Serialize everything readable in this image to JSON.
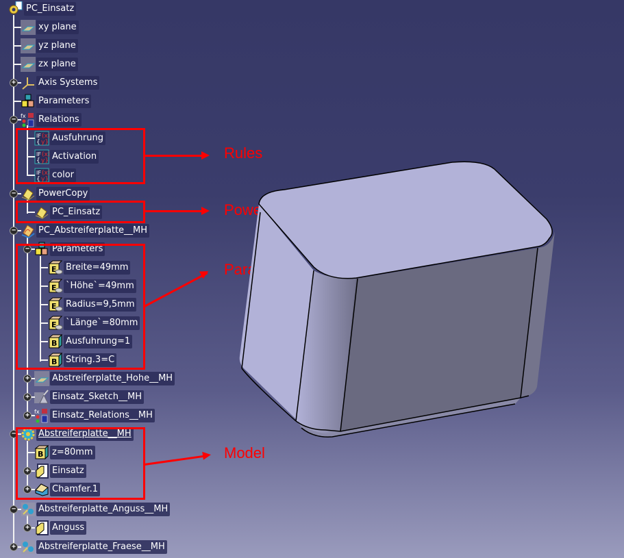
{
  "tree": {
    "root": {
      "label": "PC_Einsatz",
      "icon": "part-gear-icon"
    },
    "items": [
      {
        "label": "xy plane",
        "icon": "plane-icon"
      },
      {
        "label": "yz plane",
        "icon": "plane-icon"
      },
      {
        "label": "zx plane",
        "icon": "plane-icon"
      },
      {
        "label": "Axis Systems",
        "icon": "axis-system-icon",
        "toggle": "+"
      },
      {
        "label": "Parameters",
        "icon": "parameters-icon"
      },
      {
        "label": "Relations",
        "icon": "relations-icon",
        "toggle": "-"
      },
      {
        "label": "Ausfuhrung",
        "icon": "rule-icon"
      },
      {
        "label": "Activation",
        "icon": "rule-icon"
      },
      {
        "label": "color",
        "icon": "rule-icon"
      },
      {
        "label": "PowerCopy",
        "icon": "powercopy-icon",
        "toggle": "-"
      },
      {
        "label": "PC_Einsatz",
        "icon": "powercopy-icon"
      },
      {
        "label": "PC_Abstreiferplatte__MH",
        "icon": "powercopy-instance-icon",
        "toggle": "-"
      },
      {
        "label": "Parameters",
        "icon": "parameters-icon",
        "toggle": "-"
      },
      {
        "label": "Breite=49mm",
        "icon": "length-parameter-icon"
      },
      {
        "label": "`Höhe`=49mm",
        "icon": "length-parameter-icon"
      },
      {
        "label": "Radius=9,5mm",
        "icon": "length-parameter-icon"
      },
      {
        "label": "`Länge`=80mm",
        "icon": "length-parameter-icon"
      },
      {
        "label": "Ausfuhrung=1",
        "icon": "boolean-parameter-icon"
      },
      {
        "label": "String.3=C",
        "icon": "boolean-parameter-icon"
      },
      {
        "label": "Abstreiferplatte_Hohe__MH",
        "icon": "plane-icon",
        "toggle": "+"
      },
      {
        "label": "Einsatz_Sketch__MH",
        "icon": "sketch-icon",
        "toggle": "+"
      },
      {
        "label": "Einsatz_Relations__MH",
        "icon": "relations-icon",
        "toggle": "+"
      },
      {
        "label": "Abstreiferplatte__MH",
        "icon": "body-gear-icon",
        "toggle": "-"
      },
      {
        "label": "z=80mm",
        "icon": "boolean-parameter-icon"
      },
      {
        "label": "Einsatz",
        "icon": "pad-icon",
        "toggle": "+"
      },
      {
        "label": "Chamfer.1",
        "icon": "chamfer-icon",
        "toggle": "+"
      },
      {
        "label": "Abstreiferplatte_Anguss__MH",
        "icon": "geometric-set-icon",
        "toggle": "-"
      },
      {
        "label": "Anguss",
        "icon": "pad-icon",
        "toggle": "+"
      },
      {
        "label": "Abstreiferplatte_Fraese__MH",
        "icon": "geometric-set-icon",
        "toggle": "+"
      }
    ]
  },
  "annotations": [
    {
      "label": "Rules"
    },
    {
      "label": "Powercopie"
    },
    {
      "label": "Parameters"
    },
    {
      "label": "Model"
    }
  ],
  "colors": {
    "annotation": "#ff0000",
    "viewport_top": "#363866",
    "viewport_bottom": "#9a9bbd",
    "model_top_face": "#b2b2d8",
    "model_front_face": "#6a6a80"
  }
}
